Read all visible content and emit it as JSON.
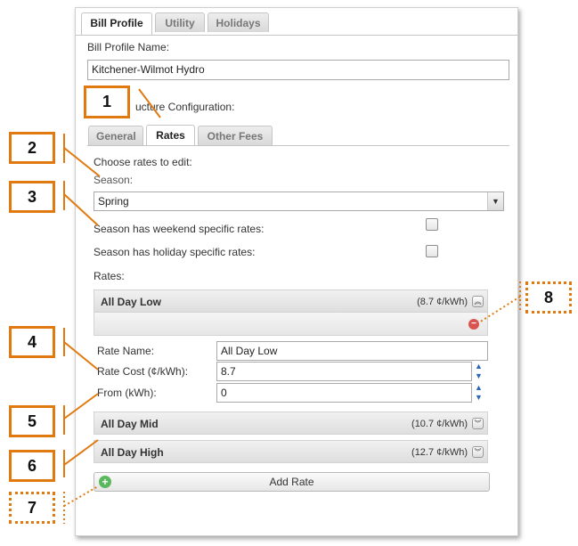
{
  "tabs": [
    {
      "label": "Bill Profile",
      "active": true
    },
    {
      "label": "Utility",
      "active": false
    },
    {
      "label": "Holidays",
      "active": false
    }
  ],
  "bill_profile_name_label": "Bill Profile Name:",
  "bill_profile_name_value": "Kitchener-Wilmot Hydro",
  "rate_structure_label": "Rate Structure Configuration:",
  "rate_structure_visible_text": "ucture Configuration:",
  "sub_tabs": [
    {
      "label": "General",
      "active": false
    },
    {
      "label": "Rates",
      "active": true
    },
    {
      "label": "Other Fees",
      "active": false
    }
  ],
  "choose_rates_label": "Choose rates to edit:",
  "season_label": "Season:",
  "season_value": "Spring",
  "weekend_checkbox_label": "Season has weekend specific rates:",
  "holiday_checkbox_label": "Season has holiday specific rates:",
  "rates_label": "Rates:",
  "rates": [
    {
      "name": "All Day Low",
      "value": "(8.7 ¢/kWh)",
      "expanded": true
    },
    {
      "name": "All Day Mid",
      "value": "(10.7 ¢/kWh)",
      "expanded": false
    },
    {
      "name": "All Day High",
      "value": "(12.7 ¢/kWh)",
      "expanded": false
    }
  ],
  "rate_form": {
    "name_label": "Rate Name:",
    "name_value": "All Day Low",
    "cost_label": "Rate Cost (¢/kWh):",
    "cost_value": "8.7",
    "from_label": "From (kWh):",
    "from_value": "0"
  },
  "add_rate_label": "Add Rate",
  "callouts": [
    "1",
    "2",
    "3",
    "4",
    "5",
    "6",
    "7",
    "8"
  ],
  "colors": {
    "callout": "#e07a10",
    "remove": "#d9534f",
    "add": "#5cb85c"
  }
}
